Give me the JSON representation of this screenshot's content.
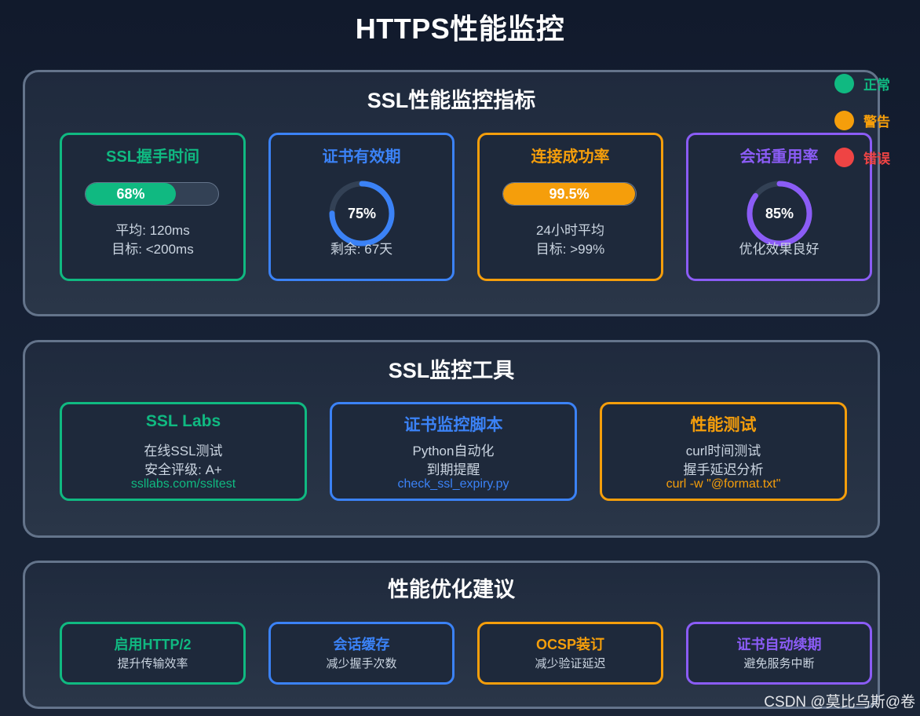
{
  "title": "HTTPS性能监控",
  "legend": [
    {
      "label": "正常",
      "color": "#10b981"
    },
    {
      "label": "警告",
      "color": "#f59e0b"
    },
    {
      "label": "错误",
      "color": "#ef4444"
    }
  ],
  "metrics_panel": {
    "title": "SSL性能监控指标",
    "cards": [
      {
        "title": "SSL握手时间",
        "type": "bar",
        "value": 0.68,
        "value_label": "68%",
        "lines": [
          "平均: 120ms",
          "目标: <200ms"
        ],
        "color": "#10b981"
      },
      {
        "title": "证书有效期",
        "type": "ring",
        "value": 0.75,
        "value_label": "75%",
        "lines": [
          "剩余: 67天"
        ],
        "color": "#3b82f6"
      },
      {
        "title": "连接成功率",
        "type": "bar",
        "value": 0.995,
        "value_label": "99.5%",
        "lines": [
          "24小时平均",
          "目标: >99%"
        ],
        "color": "#f59e0b"
      },
      {
        "title": "会话重用率",
        "type": "ring",
        "value": 0.85,
        "value_label": "85%",
        "lines": [
          "优化效果良好"
        ],
        "color": "#8b5cf6"
      }
    ]
  },
  "tools_panel": {
    "title": "SSL监控工具",
    "cards": [
      {
        "title": "SSL Labs",
        "lines": [
          "在线SSL测试",
          "安全评级: A+"
        ],
        "link": "ssllabs.com/ssltest",
        "color": "#10b981"
      },
      {
        "title": "证书监控脚本",
        "lines": [
          "Python自动化",
          "到期提醒"
        ],
        "link": "check_ssl_expiry.py",
        "color": "#3b82f6"
      },
      {
        "title": "性能测试",
        "lines": [
          "curl时间测试",
          "握手延迟分析"
        ],
        "link": "curl -w \"@format.txt\"",
        "color": "#f59e0b"
      }
    ]
  },
  "tips_panel": {
    "title": "性能优化建议",
    "cards": [
      {
        "title": "启用HTTP/2",
        "desc": "提升传输效率",
        "color": "#10b981"
      },
      {
        "title": "会话缓存",
        "desc": "减少握手次数",
        "color": "#3b82f6"
      },
      {
        "title": "OCSP装订",
        "desc": "减少验证延迟",
        "color": "#f59e0b"
      },
      {
        "title": "证书自动续期",
        "desc": "避免服务中断",
        "color": "#8b5cf6"
      }
    ]
  },
  "watermark": "CSDN @莫比乌斯@卷"
}
